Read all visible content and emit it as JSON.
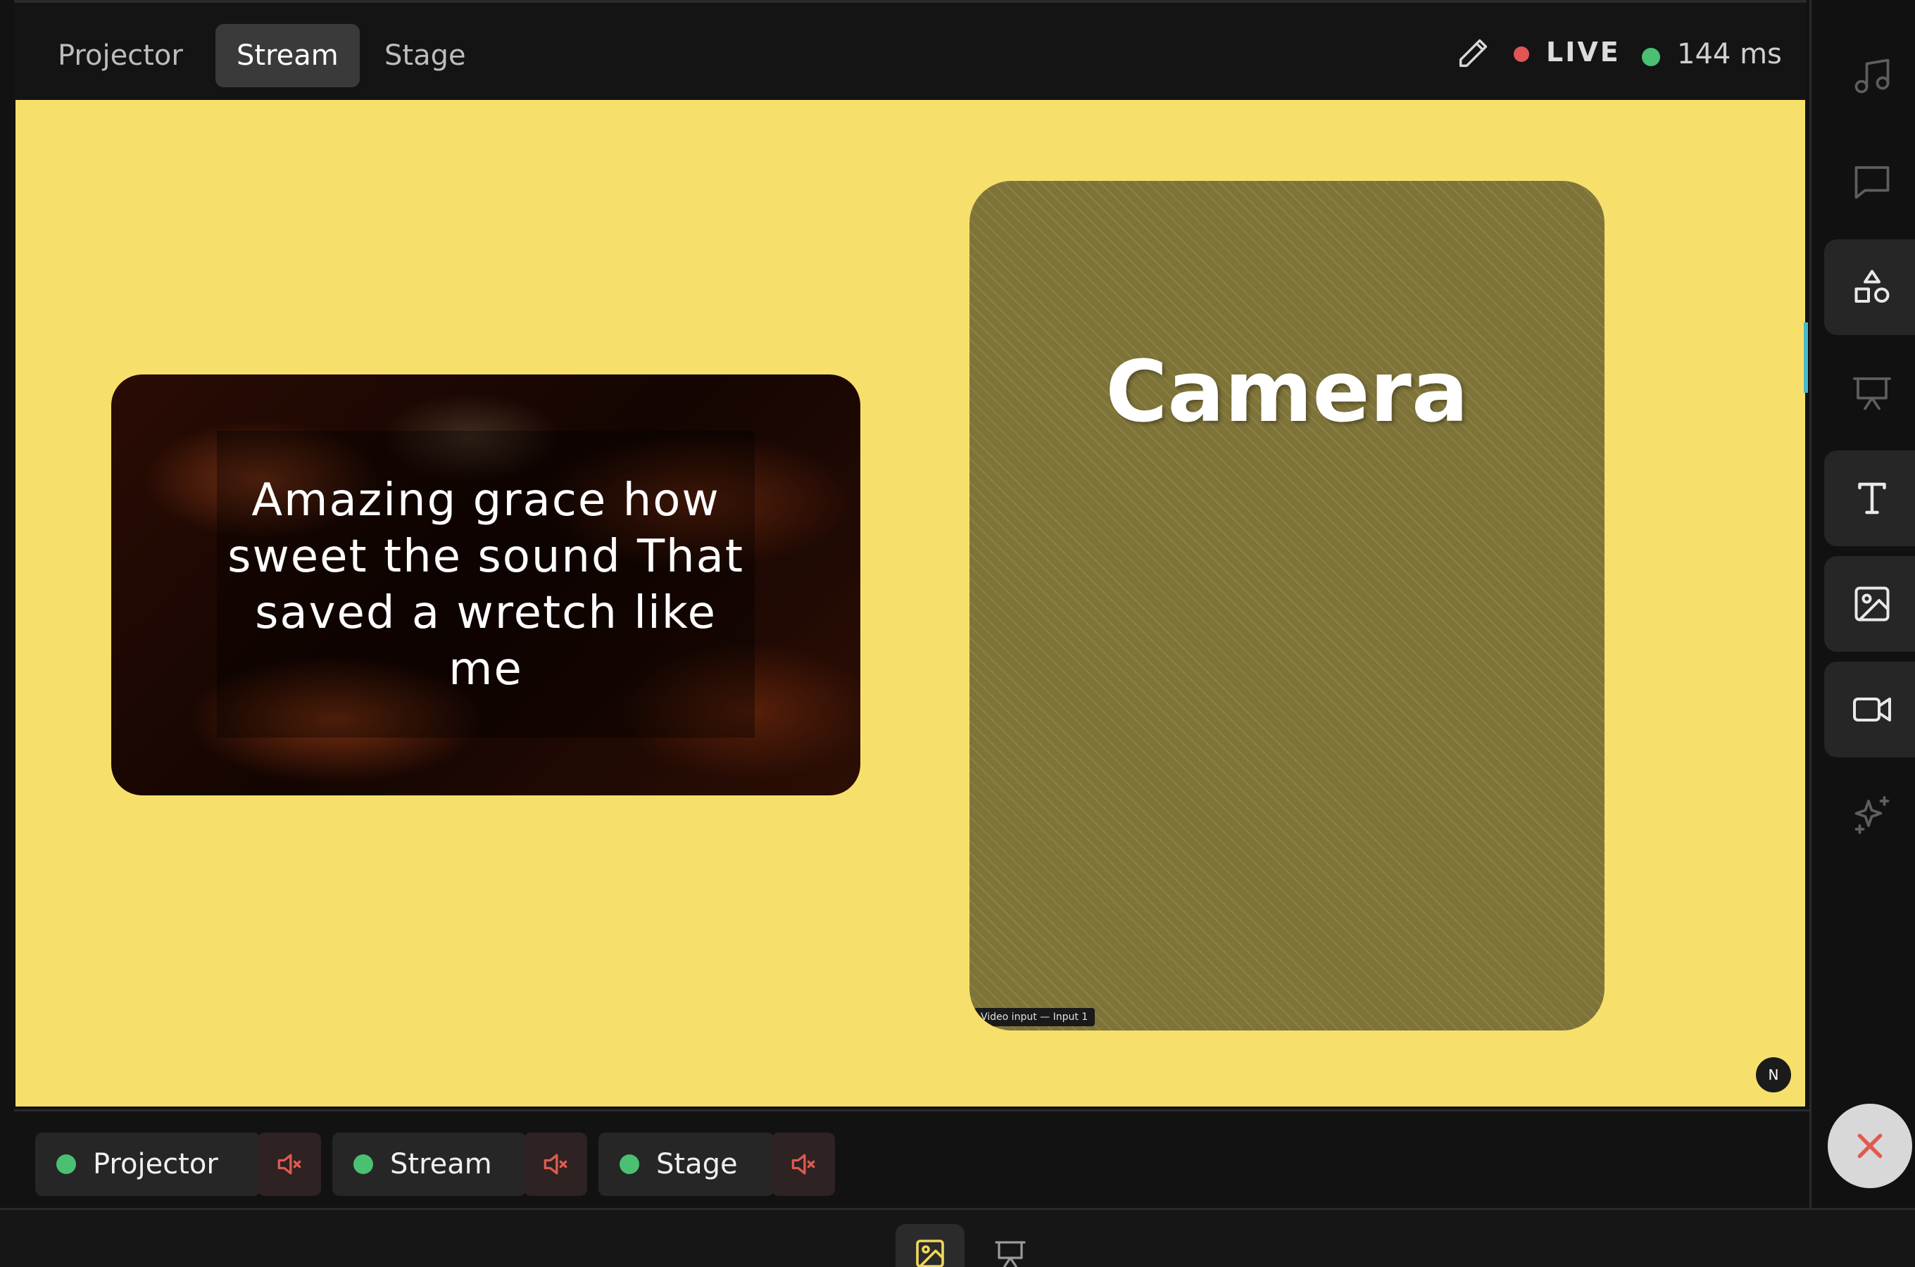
{
  "header": {
    "tabs": [
      {
        "label": "Projector"
      },
      {
        "label": "Stream"
      },
      {
        "label": "Stage"
      }
    ],
    "active_tab": "Stream",
    "live_label": "LIVE",
    "latency_label": "144 ms"
  },
  "canvas": {
    "background_color": "#f6e06b",
    "lyrics": "Amazing grace how sweet the sound That saved a wretch like me",
    "camera_label": "Camera",
    "camera_caption": "Video input — Input 1",
    "badge_letter": "N"
  },
  "sidebar": {
    "items": [
      {
        "icon": "music-note-icon"
      },
      {
        "icon": "chat-bubble-icon"
      },
      {
        "icon": "shapes-icon",
        "active": true
      },
      {
        "icon": "presentation-icon"
      },
      {
        "icon": "text-icon",
        "active": true
      },
      {
        "icon": "image-icon",
        "active": true
      },
      {
        "icon": "video-camera-icon",
        "active": true
      },
      {
        "icon": "sparkle-icon"
      }
    ]
  },
  "outputs": [
    {
      "label": "Projector",
      "status_color": "#4bbf72",
      "muted": true
    },
    {
      "label": "Stream",
      "status_color": "#4bbf72",
      "muted": true
    },
    {
      "label": "Stage",
      "status_color": "#4bbf72",
      "muted": true
    }
  ],
  "colors": {
    "live": "#e25555",
    "ok": "#4bbf72",
    "mute": "#e05a4f",
    "accent": "#49b9c9",
    "media_icon": "#f3d65a"
  }
}
